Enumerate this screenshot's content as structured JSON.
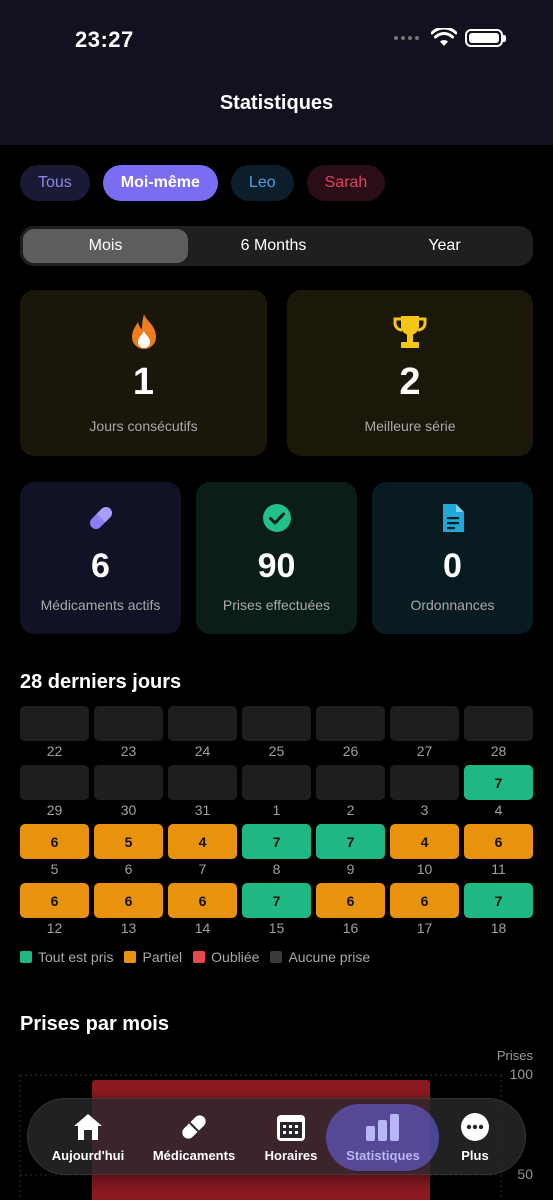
{
  "status_bar": {
    "time": "23:27"
  },
  "header": {
    "title": "Statistiques"
  },
  "filters": [
    {
      "label": "Tous",
      "state": "default"
    },
    {
      "label": "Moi-même",
      "state": "selected"
    },
    {
      "label": "Leo",
      "state": "default"
    },
    {
      "label": "Sarah",
      "state": "default"
    }
  ],
  "period": {
    "options": [
      "Mois",
      "6 Months",
      "Year"
    ],
    "selected": "Mois"
  },
  "streak_cards": {
    "current": {
      "value": "1",
      "label": "Jours consécutifs",
      "icon": "flame-icon"
    },
    "best": {
      "value": "2",
      "label": "Meilleure série",
      "icon": "trophy-icon"
    }
  },
  "stat_cards": {
    "meds": {
      "value": "6",
      "label": "Médicaments actifs",
      "icon": "pill-icon"
    },
    "doses": {
      "value": "90",
      "label": "Prises effectuées",
      "icon": "check-circle-icon"
    },
    "prescriptions": {
      "value": "0",
      "label": "Ordonnances",
      "icon": "document-icon"
    }
  },
  "calendar": {
    "title": "28 derniers jours",
    "rows": [
      {
        "cells": [
          {
            "status": "none",
            "value": ""
          },
          {
            "status": "none",
            "value": ""
          },
          {
            "status": "none",
            "value": ""
          },
          {
            "status": "none",
            "value": ""
          },
          {
            "status": "none",
            "value": ""
          },
          {
            "status": "none",
            "value": ""
          },
          {
            "status": "none",
            "value": ""
          }
        ],
        "dates": [
          "22",
          "23",
          "24",
          "25",
          "26",
          "27",
          "28"
        ]
      },
      {
        "cells": [
          {
            "status": "none",
            "value": ""
          },
          {
            "status": "none",
            "value": ""
          },
          {
            "status": "none",
            "value": ""
          },
          {
            "status": "none",
            "value": ""
          },
          {
            "status": "none",
            "value": ""
          },
          {
            "status": "none",
            "value": ""
          },
          {
            "status": "all",
            "value": "7"
          }
        ],
        "dates": [
          "29",
          "30",
          "31",
          "1",
          "2",
          "3",
          "4"
        ]
      },
      {
        "cells": [
          {
            "status": "partial",
            "value": "6"
          },
          {
            "status": "partial",
            "value": "5"
          },
          {
            "status": "partial",
            "value": "4"
          },
          {
            "status": "all",
            "value": "7"
          },
          {
            "status": "all",
            "value": "7"
          },
          {
            "status": "partial",
            "value": "4"
          },
          {
            "status": "partial",
            "value": "6"
          }
        ],
        "dates": [
          "5",
          "6",
          "7",
          "8",
          "9",
          "10",
          "11"
        ]
      },
      {
        "cells": [
          {
            "status": "partial",
            "value": "6"
          },
          {
            "status": "partial",
            "value": "6"
          },
          {
            "status": "partial",
            "value": "6"
          },
          {
            "status": "all",
            "value": "7"
          },
          {
            "status": "partial",
            "value": "6"
          },
          {
            "status": "partial",
            "value": "6"
          },
          {
            "status": "all",
            "value": "7"
          }
        ],
        "dates": [
          "12",
          "13",
          "14",
          "15",
          "16",
          "17",
          "18"
        ]
      }
    ],
    "status_colors": {
      "all": "#1fb883",
      "partial": "#e8920d",
      "missed": "#e5484d",
      "none": "#1e1e1f"
    },
    "legend": [
      {
        "label": "Tout est pris",
        "color": "#1fb883"
      },
      {
        "label": "Partiel",
        "color": "#e8920d"
      },
      {
        "label": "Oubliée",
        "color": "#e5484d"
      },
      {
        "label": "Aucune prise",
        "color": "#3a3a3c"
      }
    ]
  },
  "monthly_chart": {
    "title": "Prises par mois",
    "ylabel": "Prises",
    "ticks": [
      "100",
      "50"
    ]
  },
  "tabbar": {
    "items": [
      {
        "label": "Aujourd'hui",
        "icon": "home-icon"
      },
      {
        "label": "Médicaments",
        "icon": "pill-icon"
      },
      {
        "label": "Horaires",
        "icon": "calendar-icon"
      },
      {
        "label": "Statistiques",
        "icon": "bar-chart-icon",
        "active": true
      },
      {
        "label": "Plus",
        "icon": "more-icon"
      }
    ]
  }
}
